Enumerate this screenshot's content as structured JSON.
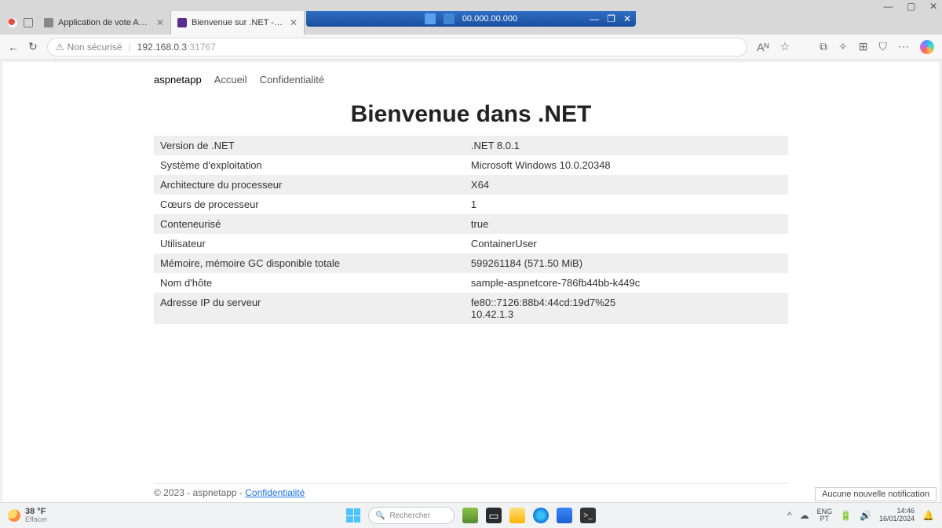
{
  "window": {
    "minimize": "—",
    "maximize": "▢",
    "close": "✕"
  },
  "rdp": {
    "ip": "00.000.00.000",
    "min": "—",
    "restore": "❐",
    "close": "✕"
  },
  "tabs": [
    {
      "title": "Application de vote Azure",
      "close": "✕"
    },
    {
      "title": "Bienvenue sur .NET - aspnet...",
      "close": "✕"
    }
  ],
  "newtab": "+",
  "addr": {
    "back": "←",
    "reload": "↻",
    "not_secure": "Non sécurisé",
    "host": "192.168.0.3",
    "port": ":31767",
    "actions": {
      "read": "Aᴺ",
      "star": "☆",
      "collections": "⧉",
      "fav": "✧",
      "ext": "⊞",
      "shield": "⛉",
      "more": "⋯"
    }
  },
  "nav": {
    "brand": "aspnetapp",
    "home": "Accueil",
    "privacy": "Confidentialité"
  },
  "heading": "Bienvenue dans .NET",
  "rows": [
    {
      "k": "Version de .NET",
      "v": ".NET 8.0.1"
    },
    {
      "k": "Système d'exploitation",
      "v": "Microsoft Windows 10.0.20348"
    },
    {
      "k": "Architecture du processeur",
      "v": "X64"
    },
    {
      "k": "Cœurs de processeur",
      "v": "1"
    },
    {
      "k": "Conteneurisé",
      "v": "true"
    },
    {
      "k": "Utilisateur",
      "v": "ContainerUser"
    },
    {
      "k": "Mémoire, mémoire GC disponible totale",
      "v": "599261184 (571.50 MiB)"
    },
    {
      "k": "Nom d'hôte",
      "v": "sample-aspnetcore-786fb44bb-k449c"
    },
    {
      "k": "Adresse IP du serveur",
      "v": "fe80::7126:88b4:44cd:19d7%25\n10.42.1.3"
    }
  ],
  "footer": {
    "text": "© 2023 - aspnetapp - ",
    "privacy": "Confidentialité"
  },
  "toast": "Aucune nouvelle notification",
  "taskbar": {
    "weather_temp": "38 °F",
    "weather_label": "Effacer",
    "search_placeholder": "Rechercher",
    "chevron": "^",
    "cloud": "☁",
    "lang1": "ENG",
    "lang2": "PT",
    "battery": "🔋",
    "speaker": "🔊",
    "time": "14:46",
    "date": "16/01/2024",
    "bell": "🔔"
  }
}
